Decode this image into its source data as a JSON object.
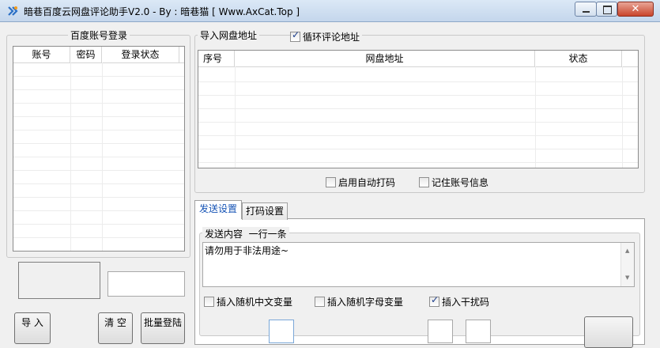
{
  "window": {
    "title": "暗巷百度云网盘评论助手V2.0 - By : 暗巷猫 [ Www.AxCat.Top ]"
  },
  "accounts": {
    "group_title": "百度账号登录",
    "columns": [
      "账号",
      "密码",
      "登录状态"
    ]
  },
  "urls": {
    "group_title": "导入网盘地址",
    "loop_label": "循环评论地址",
    "loop_checked": true,
    "columns": [
      "序号",
      "网盘地址",
      "状态"
    ]
  },
  "options": {
    "auto_captcha_label": "启用自动打码",
    "auto_captcha_checked": false,
    "remember_label": "记住账号信息",
    "remember_checked": false
  },
  "tabs": [
    {
      "label": "发送设置",
      "active": true
    },
    {
      "label": "打码设置",
      "active": false
    }
  ],
  "send": {
    "group_title": "发送内容  一行一条",
    "content": "请勿用于非法用途~",
    "rand_cn_label": "插入随机中文变量",
    "rand_cn_checked": false,
    "rand_letter_label": "插入随机字母变量",
    "rand_letter_checked": false,
    "noise_label": "插入干扰码",
    "noise_checked": true
  },
  "bottom_buttons": [
    "导 入",
    "清 空",
    "批量登陆"
  ]
}
